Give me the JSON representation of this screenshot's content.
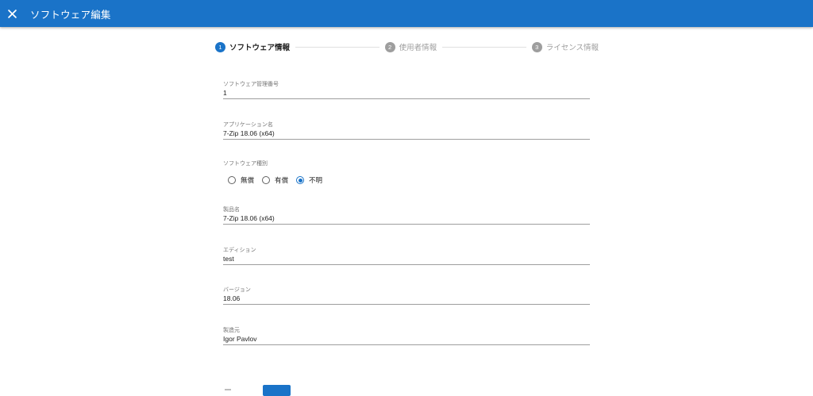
{
  "appbar": {
    "title": "ソフトウェア編集",
    "close_icon": "close-icon"
  },
  "stepper": {
    "steps": [
      {
        "number": "1",
        "label": "ソフトウェア情報",
        "active": true
      },
      {
        "number": "2",
        "label": "使用者情報",
        "active": false
      },
      {
        "number": "3",
        "label": "ライセンス情報",
        "active": false
      }
    ]
  },
  "form": {
    "software_id": {
      "label": "ソフトウェア管理番号",
      "value": "1"
    },
    "app_name": {
      "label": "アプリケーション名",
      "value": "7-Zip 18.06 (x64)"
    },
    "software_type": {
      "label": "ソフトウェア種別",
      "options": [
        "無償",
        "有償",
        "不明"
      ],
      "selected": "不明"
    },
    "product_name": {
      "label": "製品名",
      "value": "7-Zip 18.06 (x64)"
    },
    "edition": {
      "label": "エディション",
      "value": "test"
    },
    "version": {
      "label": "バージョン",
      "value": "18.06"
    },
    "manufacturer": {
      "label": "製造元",
      "value": "Igor Pavlov"
    }
  },
  "colors": {
    "primary": "#1a73c8",
    "inactive_step": "#9e9e9e"
  }
}
